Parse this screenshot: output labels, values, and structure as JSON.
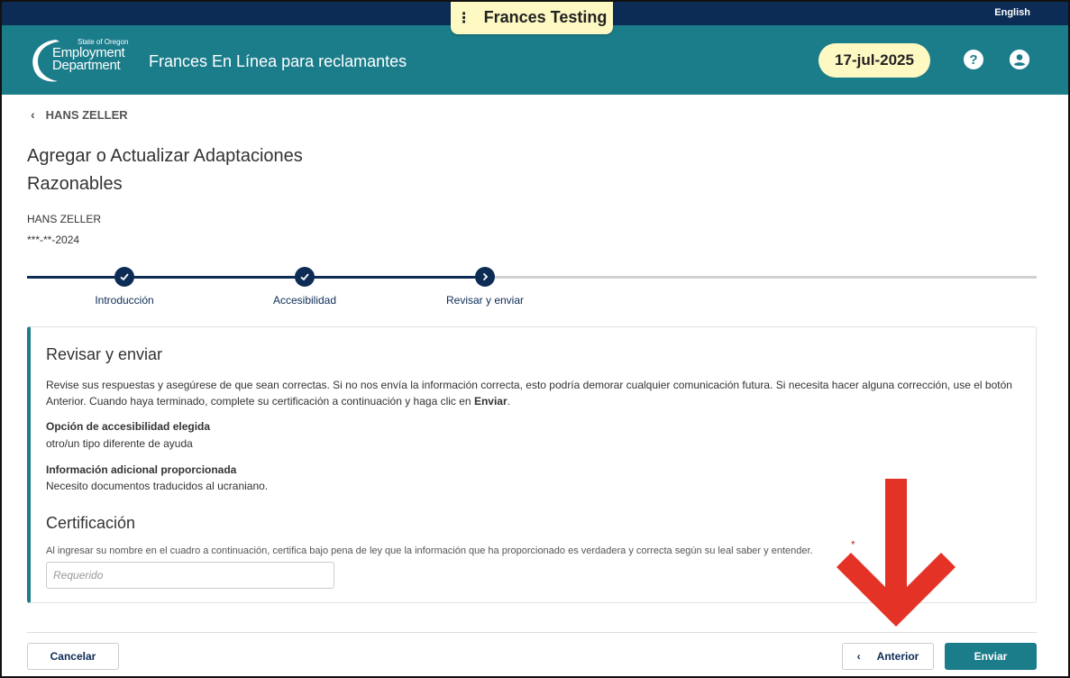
{
  "topbar": {
    "language_link": "English"
  },
  "env_badge": {
    "dots_icon": "vertical-dots-icon",
    "label": "Frances Testing"
  },
  "header": {
    "logo": {
      "line1": "State of Oregon",
      "line2": "Employment",
      "line3": "Department"
    },
    "app_title": "Frances En Línea para reclamantes",
    "date": "17-jul-2025",
    "help_icon": "?",
    "account_icon": "user-icon"
  },
  "back": {
    "label": "HANS ZELLER"
  },
  "page": {
    "title": "Agregar o Actualizar Adaptaciones Razonables",
    "person_name": "HANS ZELLER",
    "person_ssn": "***-**-2024"
  },
  "stepper": {
    "steps": [
      {
        "label": "Introducción",
        "status": "complete"
      },
      {
        "label": "Accesibilidad",
        "status": "complete"
      },
      {
        "label": "Revisar y enviar",
        "status": "current"
      }
    ]
  },
  "review": {
    "title": "Revisar y enviar",
    "desc_text": "Revise sus respuestas y asegúrese de que sean correctas. Si no nos envía la información correcta, esto podría demorar cualquier comunicación futura. Si necesita hacer alguna corrección, use el botón Anterior. Cuando haya terminado, complete su certificación a continuación y haga clic en ",
    "desc_bold": "Enviar",
    "desc_end": ".",
    "accessibility_label": "Opción de accesibilidad elegida",
    "accessibility_value": "otro/un tipo diferente de ayuda",
    "additional_label": "Información adicional proporcionada",
    "additional_value": "Necesito documentos traducidos al ucraniano."
  },
  "certification": {
    "title": "Certificación",
    "text": "Al ingresar su nombre en el cuadro a continuación, certifica bajo pena de ley que la información que ha proporcionado es verdadera y correcta según su leal saber y entender.",
    "required_mark": "*",
    "placeholder": "Requerido",
    "value": ""
  },
  "footer": {
    "cancel_label": "Cancelar",
    "previous_label": "Anterior",
    "submit_label": "Enviar"
  },
  "colors": {
    "header_teal": "#1b7c8a",
    "navy": "#0d2c55",
    "highlight_yellow": "#fef9c3",
    "annotation_red": "#e53227"
  }
}
